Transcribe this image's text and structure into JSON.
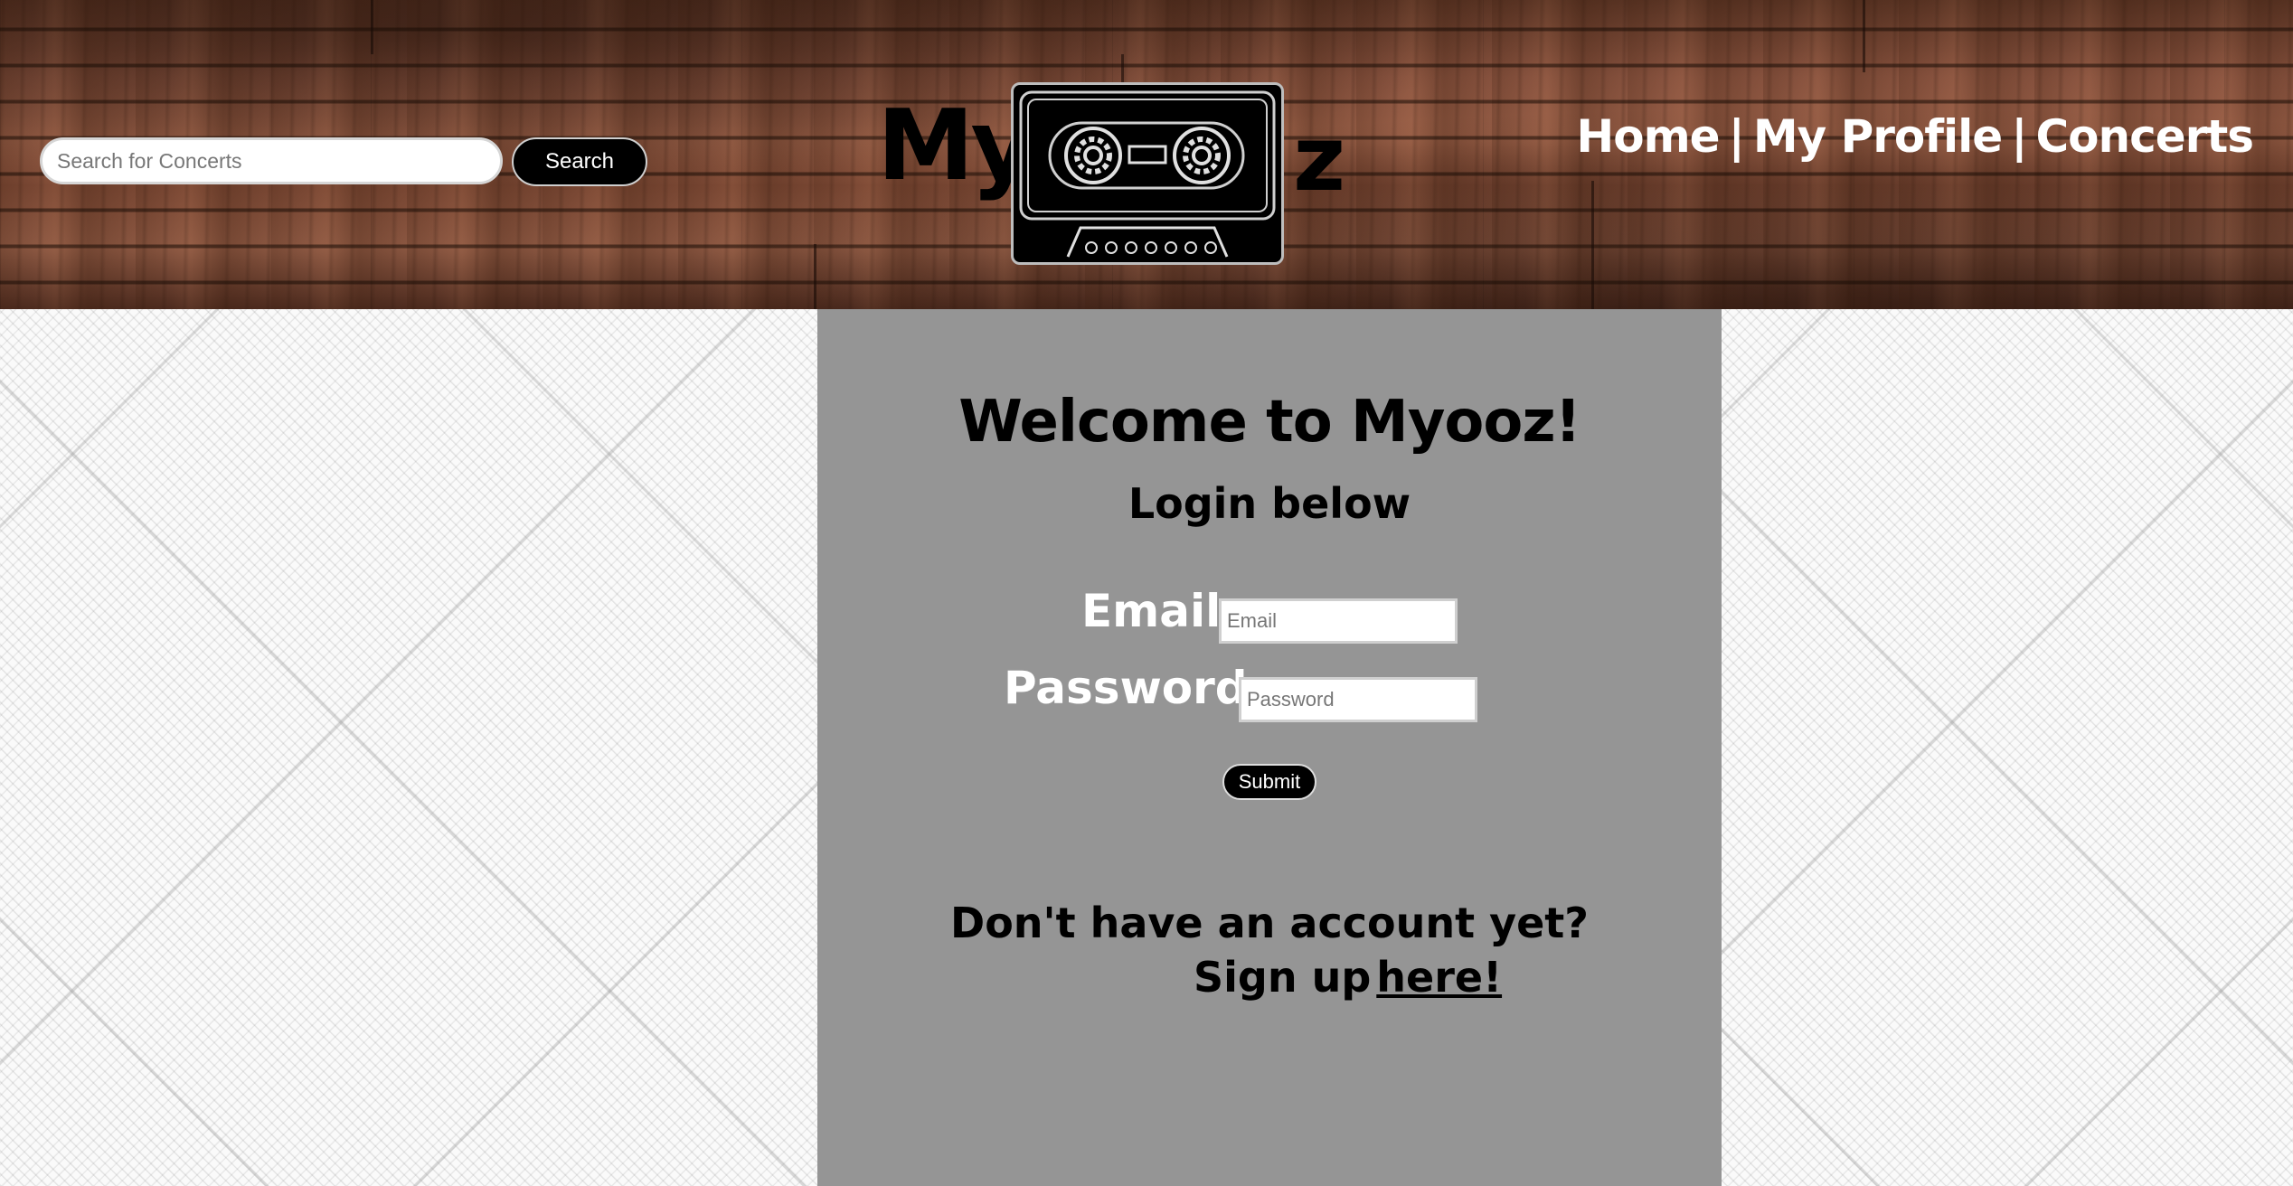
{
  "header": {
    "search": {
      "placeholder": "Search for Concerts",
      "value": "",
      "button_label": "Search"
    },
    "logo": {
      "text_left": "My",
      "text_right": "z",
      "icon": "cassette-tape-icon"
    },
    "nav": {
      "items": [
        {
          "label": "Home"
        },
        {
          "label": "My Profile"
        },
        {
          "label": "Concerts"
        }
      ],
      "separator": "|"
    }
  },
  "main": {
    "title": "Welcome to Myooz!",
    "subtitle": "Login below",
    "email_label": "Email:",
    "email_placeholder": "Email",
    "password_label": "Password:",
    "password_placeholder": "Password",
    "submit_label": "Submit",
    "no_account_text": "Don't have an account yet?",
    "signup_prefix": "Sign up",
    "signup_link": "here!"
  },
  "colors": {
    "panel_background": "#959595",
    "button_background": "#000000",
    "nav_text": "#ffffff"
  }
}
